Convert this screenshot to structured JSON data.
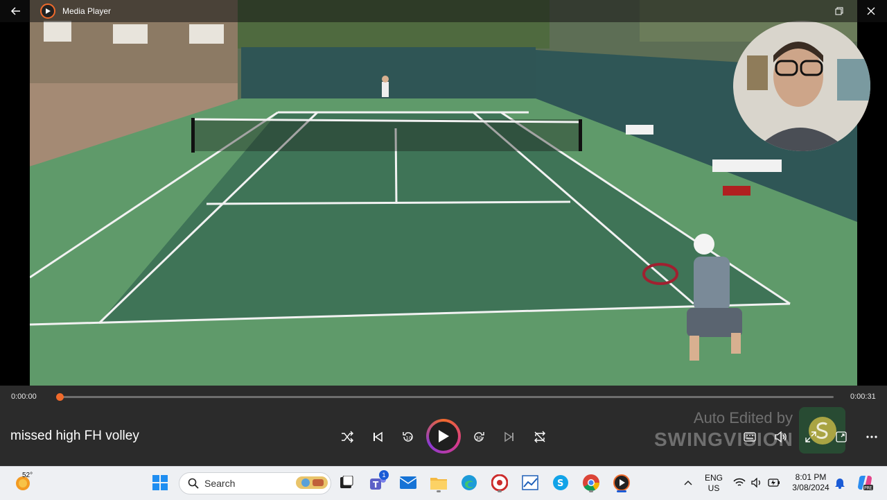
{
  "window": {
    "title": "Media Player"
  },
  "player": {
    "media_title": "missed high FH volley",
    "current_time": "0:00:00",
    "total_time": "0:00:31",
    "progress": 0.0
  },
  "watermark": {
    "line1": "Auto Edited by",
    "line2": "SWINGVISION"
  },
  "taskbar": {
    "weather_temp": "52°",
    "search_placeholder": "Search",
    "teams_badge": "1",
    "language_line1": "ENG",
    "language_line2": "US",
    "time": "8:01 PM",
    "date": "3/08/2024"
  },
  "colors": {
    "accent": "#f06a2b",
    "court_green": "#3f7457",
    "outer_green": "#5f9a6a",
    "panel_bg": "#2b2b2b"
  }
}
